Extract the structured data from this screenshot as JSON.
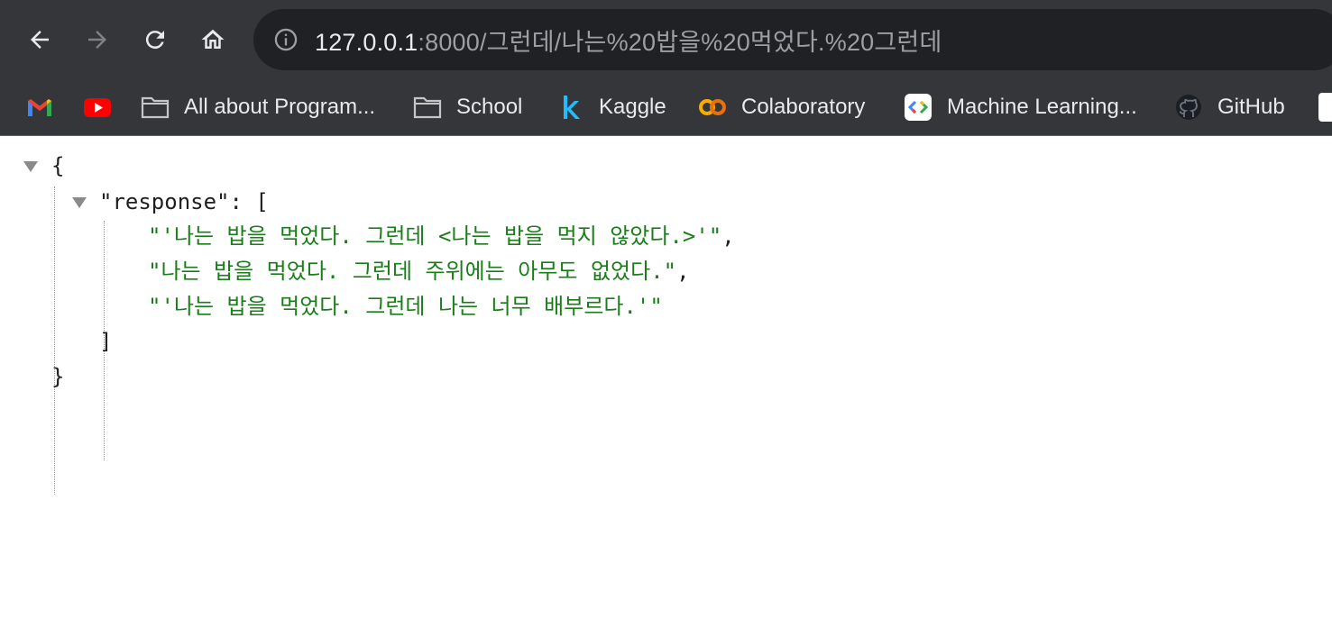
{
  "browser": {
    "url_host": "127.0.0.1",
    "url_path": ":8000/그런데/나는%20밥을%20먹었다.%20그런데"
  },
  "bookmarks": [
    {
      "label": "",
      "icon": "gmail-icon"
    },
    {
      "label": "",
      "icon": "youtube-icon"
    },
    {
      "label": "All about Program...",
      "icon": "folder-icon"
    },
    {
      "label": "School",
      "icon": "folder-icon"
    },
    {
      "label": "Kaggle",
      "icon": "kaggle-icon"
    },
    {
      "label": "Colaboratory",
      "icon": "colab-icon"
    },
    {
      "label": "Machine Learning...",
      "icon": "google-developers-icon"
    },
    {
      "label": "GitHub",
      "icon": "github-icon"
    }
  ],
  "json": {
    "open_brace": "{",
    "key": "\"response\"",
    "colon_bracket": ": [",
    "items": [
      "\"'나는 밥을 먹었다. 그런데 <나는 밥을 먹지 않았다.>'\"",
      "\"나는 밥을 먹었다. 그런데 주위에는 아무도 없었다.\"",
      "\"'나는 밥을 먹었다. 그런데 나는 너무 배부르다.'\""
    ],
    "comma": ",",
    "close_bracket": "]",
    "close_brace": "}"
  },
  "colors": {
    "chrome_bg": "#35363a",
    "omnibox_bg": "#202124",
    "json_string": "#1a7d1a"
  }
}
